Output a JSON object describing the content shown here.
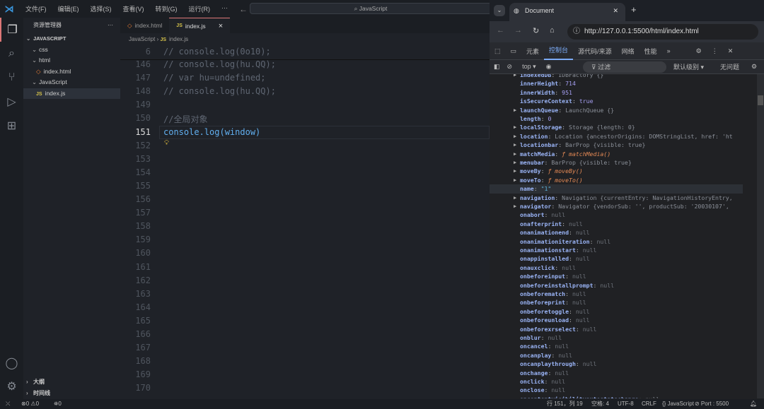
{
  "titlebar": {
    "menus": [
      "文件(F)",
      "编辑(E)",
      "选择(S)",
      "查看(V)",
      "转到(G)",
      "运行(R)",
      "···"
    ],
    "search": "JavaScript"
  },
  "sidebar": {
    "title": "资源管理器",
    "more": "···",
    "root": "JAVASCRIPT",
    "items": [
      {
        "label": "css",
        "type": "folder"
      },
      {
        "label": "html",
        "type": "folder"
      },
      {
        "label": "index.html",
        "type": "html"
      },
      {
        "label": "JavaScript",
        "type": "folder"
      },
      {
        "label": "index.js",
        "type": "js"
      }
    ],
    "outline": "大纲",
    "timeline": "时间线"
  },
  "tabs": [
    {
      "label": "index.html",
      "icon": "html"
    },
    {
      "label": "index.js",
      "icon": "js",
      "close": "×"
    }
  ],
  "breadcrumb": {
    "folder": "JavaScript",
    "file": "index.js"
  },
  "editor": {
    "lines": [
      {
        "n": "6",
        "code": "// console.log(0o10);"
      },
      {
        "n": "146",
        "code": "// console.log(hu.QQ);"
      },
      {
        "n": "147",
        "code": "// var hu=undefined;"
      },
      {
        "n": "148",
        "code": "// console.log(hu.QQ);"
      },
      {
        "n": "149",
        "code": ""
      },
      {
        "n": "150",
        "code": "//全局对象"
      },
      {
        "n": "151",
        "code": "console.log(window)"
      },
      {
        "n": "152",
        "code": ""
      },
      {
        "n": "153",
        "code": ""
      },
      {
        "n": "154",
        "code": ""
      },
      {
        "n": "155",
        "code": ""
      },
      {
        "n": "156",
        "code": ""
      },
      {
        "n": "157",
        "code": ""
      },
      {
        "n": "158",
        "code": ""
      },
      {
        "n": "159",
        "code": ""
      },
      {
        "n": "160",
        "code": ""
      },
      {
        "n": "161",
        "code": ""
      },
      {
        "n": "162",
        "code": ""
      },
      {
        "n": "163",
        "code": ""
      },
      {
        "n": "164",
        "code": ""
      },
      {
        "n": "165",
        "code": ""
      },
      {
        "n": "166",
        "code": ""
      },
      {
        "n": "167",
        "code": ""
      },
      {
        "n": "168",
        "code": ""
      },
      {
        "n": "169",
        "code": ""
      },
      {
        "n": "170",
        "code": ""
      }
    ]
  },
  "browser": {
    "tab_title": "Document",
    "url": "http://127.0.0.1:5500/html/index.html",
    "devtools_tabs": [
      "元素",
      "控制台",
      "源代码/来源",
      "网络",
      "性能",
      "»"
    ],
    "context": "top ▾",
    "filter": "过滤",
    "level": "默认级别 ▾",
    "issues": "无问题",
    "rows": [
      {
        "exp": true,
        "k": "indexedDB",
        "v": "IDBFactory  {}",
        "t": "pv"
      },
      {
        "exp": false,
        "k": "innerHeight",
        "v": "714",
        "t": "num"
      },
      {
        "exp": false,
        "k": "innerWidth",
        "v": "951",
        "t": "num"
      },
      {
        "exp": false,
        "k": "isSecureContext",
        "v": "true",
        "t": "num"
      },
      {
        "exp": true,
        "k": "launchQueue",
        "v": "LaunchQueue  {}",
        "t": "pv"
      },
      {
        "exp": false,
        "k": "length",
        "v": "0",
        "t": "num"
      },
      {
        "exp": true,
        "k": "localStorage",
        "v": "Storage  {length: 0}",
        "t": "pv"
      },
      {
        "exp": true,
        "k": "location",
        "v": "Location  {ancestorOrigins: DOMStringList, href: 'ht",
        "t": "pv"
      },
      {
        "exp": true,
        "k": "locationbar",
        "v": "BarProp  {visible: true}",
        "t": "pv"
      },
      {
        "exp": true,
        "k": "matchMedia",
        "v": "ƒ matchMedia()",
        "t": "fn"
      },
      {
        "exp": true,
        "k": "menubar",
        "v": "BarProp  {visible: true}",
        "t": "pv"
      },
      {
        "exp": true,
        "k": "moveBy",
        "v": "ƒ moveBy()",
        "t": "fn"
      },
      {
        "exp": true,
        "k": "moveTo",
        "v": "ƒ moveTo()",
        "t": "fn"
      },
      {
        "exp": false,
        "k": "name",
        "v": "\"1\"",
        "t": "str",
        "hl": true
      },
      {
        "exp": true,
        "k": "navigation",
        "v": "Navigation  {currentEntry: NavigationHistoryEntry,",
        "t": "pv"
      },
      {
        "exp": true,
        "k": "navigator",
        "v": "Navigator  {vendorSub: '', productSub: '20030107',",
        "t": "pv"
      },
      {
        "exp": false,
        "k": "onabort",
        "v": "null",
        "t": "nul"
      },
      {
        "exp": false,
        "k": "onafterprint",
        "v": "null",
        "t": "nul"
      },
      {
        "exp": false,
        "k": "onanimationend",
        "v": "null",
        "t": "nul"
      },
      {
        "exp": false,
        "k": "onanimationiteration",
        "v": "null",
        "t": "nul"
      },
      {
        "exp": false,
        "k": "onanimationstart",
        "v": "null",
        "t": "nul"
      },
      {
        "exp": false,
        "k": "onappinstalled",
        "v": "null",
        "t": "nul"
      },
      {
        "exp": false,
        "k": "onauxclick",
        "v": "null",
        "t": "nul"
      },
      {
        "exp": false,
        "k": "onbeforeinput",
        "v": "null",
        "t": "nul"
      },
      {
        "exp": false,
        "k": "onbeforeinstallprompt",
        "v": "null",
        "t": "nul"
      },
      {
        "exp": false,
        "k": "onbeforematch",
        "v": "null",
        "t": "nul"
      },
      {
        "exp": false,
        "k": "onbeforeprint",
        "v": "null",
        "t": "nul"
      },
      {
        "exp": false,
        "k": "onbeforetoggle",
        "v": "null",
        "t": "nul"
      },
      {
        "exp": false,
        "k": "onbeforeunload",
        "v": "null",
        "t": "nul"
      },
      {
        "exp": false,
        "k": "onbeforexrselect",
        "v": "null",
        "t": "nul"
      },
      {
        "exp": false,
        "k": "onblur",
        "v": "null",
        "t": "nul"
      },
      {
        "exp": false,
        "k": "oncancel",
        "v": "null",
        "t": "nul"
      },
      {
        "exp": false,
        "k": "oncanplay",
        "v": "null",
        "t": "nul"
      },
      {
        "exp": false,
        "k": "oncanplaythrough",
        "v": "null",
        "t": "nul"
      },
      {
        "exp": false,
        "k": "onchange",
        "v": "null",
        "t": "nul"
      },
      {
        "exp": false,
        "k": "onclick",
        "v": "null",
        "t": "nul"
      },
      {
        "exp": false,
        "k": "onclose",
        "v": "null",
        "t": "nul"
      },
      {
        "exp": false,
        "k": "oncontentvisibilityautostatechange",
        "v": "null",
        "t": "nul"
      }
    ]
  },
  "status": {
    "errors": "0",
    "warnings": "0",
    "ports": "0",
    "position": "行 151，列 19",
    "spaces": "空格: 4",
    "encoding": "UTF-8",
    "eol": "CRLF",
    "language": "{} JavaScript",
    "port": "⊘ Port : 5500"
  }
}
